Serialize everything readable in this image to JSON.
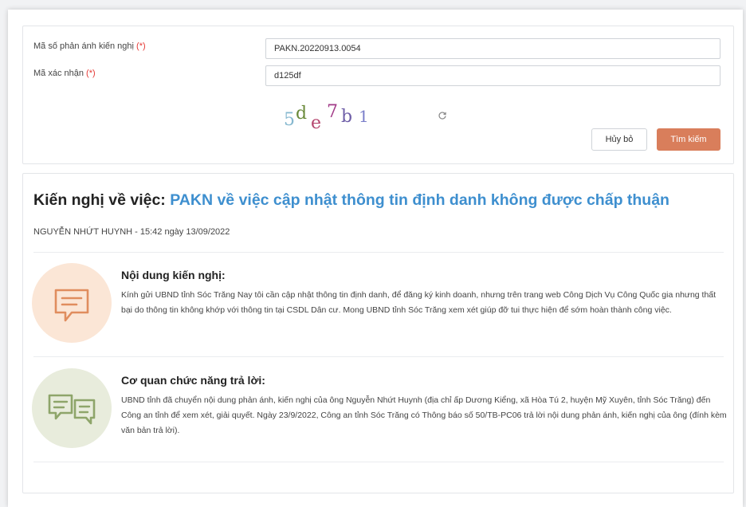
{
  "search": {
    "code_label": "Mã số phản ánh kiến nghị",
    "code_required": "(*)",
    "code_value": "PAKN.20220913.0054",
    "confirm_label": "Mã xác nhận",
    "confirm_required": "(*)",
    "confirm_value": "d125df",
    "captcha_chars": [
      "5",
      "d",
      "e",
      "7",
      "b",
      "1"
    ],
    "refresh_icon": "refresh-icon",
    "cancel_label": "Hủy bỏ",
    "search_label": "Tìm kiếm"
  },
  "result": {
    "title_prefix": "Kiến nghị về việc:",
    "title_subject": "PAKN về việc cập nhật thông tin định danh không được chấp thuận",
    "meta": "NGUYỄN NHỨT HUYNH - 15:42 ngày 13/09/2022",
    "content": {
      "heading": "Nội dung kiến nghị:",
      "body": "Kính gửi UBND tỉnh Sóc Trăng Nay tôi cần cập nhật thông tin định danh, để đăng ký kinh doanh, nhưng trên trang web Công Dịch Vụ Công Quốc gia nhưng thất bại do thông tin không khớp với thông tin tại CSDL Dân cư. Mong UBND tỉnh Sóc Trăng xem xét giúp đỡ tui thực hiện để sớm hoàn thành công việc.",
      "icon": "message-icon"
    },
    "reply": {
      "heading": "Cơ quan chức năng trả lời:",
      "body": "UBND tỉnh đã chuyển nội dung phản ánh, kiến nghị của ông Nguyễn Nhứt Huynh (địa chỉ ấp Dương Kiểng, xã Hòa Tú 2, huyện Mỹ Xuyên, tỉnh Sóc Trăng) đến Công an tỉnh để xem xét, giải quyết. Ngày 23/9/2022, Công an tỉnh Sóc Trăng có Thông báo số 50/TB-PC06 trả lời nội dung phản ánh, kiến nghị của ông (đính kèm văn bản trả lời).",
      "icon": "conversation-icon"
    }
  },
  "colors": {
    "accent_blue": "#3e8fcf",
    "button_orange": "#d97e5b",
    "required_red": "#e53935",
    "content_circle": "#fbe6d6",
    "reply_circle": "#e8ecdc"
  }
}
